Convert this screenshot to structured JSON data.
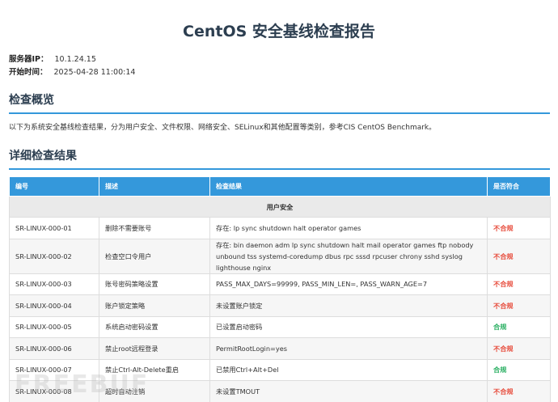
{
  "report": {
    "title": "CentOS 安全基线检查报告",
    "server_ip_label": "服务器IP：",
    "server_ip": "10.1.24.15",
    "start_time_label": "开始时间：",
    "start_time": "2025-04-28 11:00:14"
  },
  "overview": {
    "heading": "检查概览",
    "text": "以下为系统安全基线检查结果，分为用户安全、文件权限、网络安全、SELinux和其他配置等类别，参考CIS CentOS Benchmark。"
  },
  "details": {
    "heading": "详细检查结果",
    "columns": [
      "编号",
      "描述",
      "检查结果",
      "是否符合"
    ],
    "section": "用户安全",
    "rows": [
      {
        "id": "SR-LINUX-000-01",
        "desc": "删除不需要账号",
        "result": "存在: lp sync shutdown halt operator games",
        "status": "不合规"
      },
      {
        "id": "SR-LINUX-000-02",
        "desc": "检查空口令用户",
        "result": "存在: bin daemon adm lp sync shutdown halt mail operator games ftp nobody unbound tss systemd-coredump dbus rpc sssd rpcuser chrony sshd syslog lighthouse nginx",
        "status": "不合规"
      },
      {
        "id": "SR-LINUX-000-03",
        "desc": "账号密码策略设置",
        "result": "PASS_MAX_DAYS=99999, PASS_MIN_LEN=, PASS_WARN_AGE=7",
        "status": "不合规"
      },
      {
        "id": "SR-LINUX-000-04",
        "desc": "账户锁定策略",
        "result": "未设置账户锁定",
        "status": "不合规"
      },
      {
        "id": "SR-LINUX-000-05",
        "desc": "系统启动密码设置",
        "result": "已设置启动密码",
        "status": "合规"
      },
      {
        "id": "SR-LINUX-000-06",
        "desc": "禁止root远程登录",
        "result": "PermitRootLogin=yes",
        "status": "不合规"
      },
      {
        "id": "SR-LINUX-000-07",
        "desc": "禁止Ctrl-Alt-Delete重启",
        "result": "已禁用Ctrl+Alt+Del",
        "status": "合规"
      },
      {
        "id": "SR-LINUX-000-08",
        "desc": "超时自动注销",
        "result": "未设置TMOUT",
        "status": "不合规"
      }
    ]
  },
  "colors": {
    "heading": "#2c3e50",
    "accent": "#3498db",
    "non_compliant": "#e74c3c",
    "compliant": "#27ae60"
  },
  "watermark": "FREEBUF"
}
